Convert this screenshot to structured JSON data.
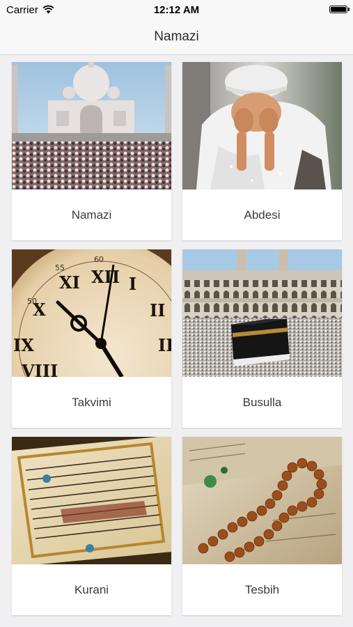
{
  "status_bar": {
    "carrier": "Carrier",
    "time": "12:12 AM"
  },
  "nav": {
    "title": "Namazi"
  },
  "items": [
    {
      "label": "Namazi",
      "icon": "mosque-prayer-photo"
    },
    {
      "label": "Abdesi",
      "icon": "ablution-child-photo"
    },
    {
      "label": "Takvimi",
      "icon": "clock-photo"
    },
    {
      "label": "Busulla",
      "icon": "kaaba-photo"
    },
    {
      "label": "Kurani",
      "icon": "quran-photo"
    },
    {
      "label": "Tesbih",
      "icon": "prayer-beads-photo"
    }
  ]
}
